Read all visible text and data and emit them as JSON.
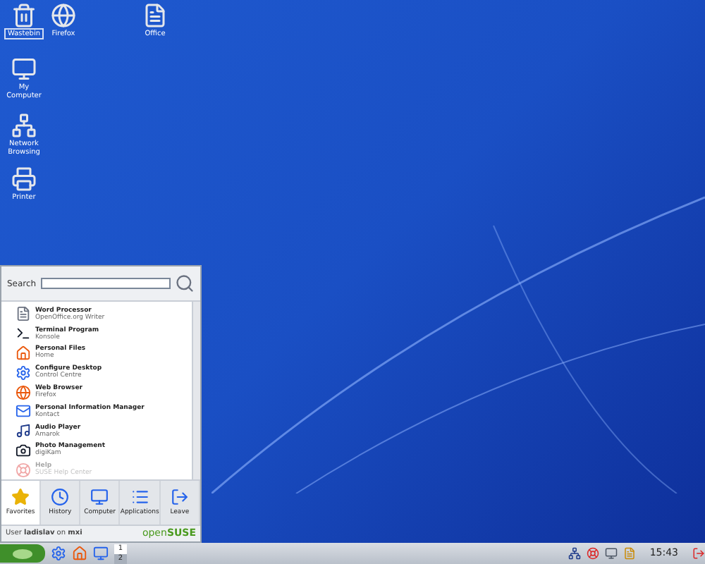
{
  "desktop_icons": [
    {
      "label": "Wastebin",
      "kind": "trash",
      "selected": true
    },
    {
      "label": "Firefox",
      "kind": "browser",
      "selected": false
    },
    {
      "label": "Office",
      "kind": "office",
      "selected": false
    },
    {
      "label": "My Computer",
      "kind": "computer",
      "selected": false
    },
    {
      "label": "Network Browsing",
      "kind": "network",
      "selected": false
    },
    {
      "label": "Printer",
      "kind": "printer",
      "selected": false
    }
  ],
  "menu": {
    "search": {
      "label": "Search"
    },
    "items": [
      {
        "title": "Word Processor",
        "subtitle": "OpenOffice.org Writer",
        "kind": "writer",
        "disabled": false
      },
      {
        "title": "Terminal Program",
        "subtitle": "Konsole",
        "kind": "terminal",
        "disabled": false
      },
      {
        "title": "Personal Files",
        "subtitle": "Home",
        "kind": "home",
        "disabled": false
      },
      {
        "title": "Configure Desktop",
        "subtitle": "Control Centre",
        "kind": "config",
        "disabled": false
      },
      {
        "title": "Web Browser",
        "subtitle": "Firefox",
        "kind": "browser",
        "disabled": false
      },
      {
        "title": "Personal Information Manager",
        "subtitle": "Kontact",
        "kind": "pim",
        "disabled": false
      },
      {
        "title": "Audio Player",
        "subtitle": "Amarok",
        "kind": "audio",
        "disabled": false
      },
      {
        "title": "Photo Management",
        "subtitle": "digiKam",
        "kind": "camera",
        "disabled": false
      },
      {
        "title": "Help",
        "subtitle": "SUSE Help Center",
        "kind": "help",
        "disabled": true
      }
    ],
    "tabs": [
      {
        "label": "Favorites",
        "kind": "star",
        "selected": true
      },
      {
        "label": "History",
        "kind": "clock",
        "selected": false
      },
      {
        "label": "Computer",
        "kind": "computer",
        "selected": false
      },
      {
        "label": "Applications",
        "kind": "list",
        "selected": false
      },
      {
        "label": "Leave",
        "kind": "leave",
        "selected": false
      }
    ],
    "footer": {
      "user_line": "User **ladislav** on **mxi**",
      "brand_prefix": "open",
      "brand_suffix": "SUSE"
    }
  },
  "taskbar": {
    "pager": [
      {
        "label": "1",
        "selected": true
      },
      {
        "label": "2",
        "selected": false
      }
    ],
    "clock": "15:43"
  }
}
